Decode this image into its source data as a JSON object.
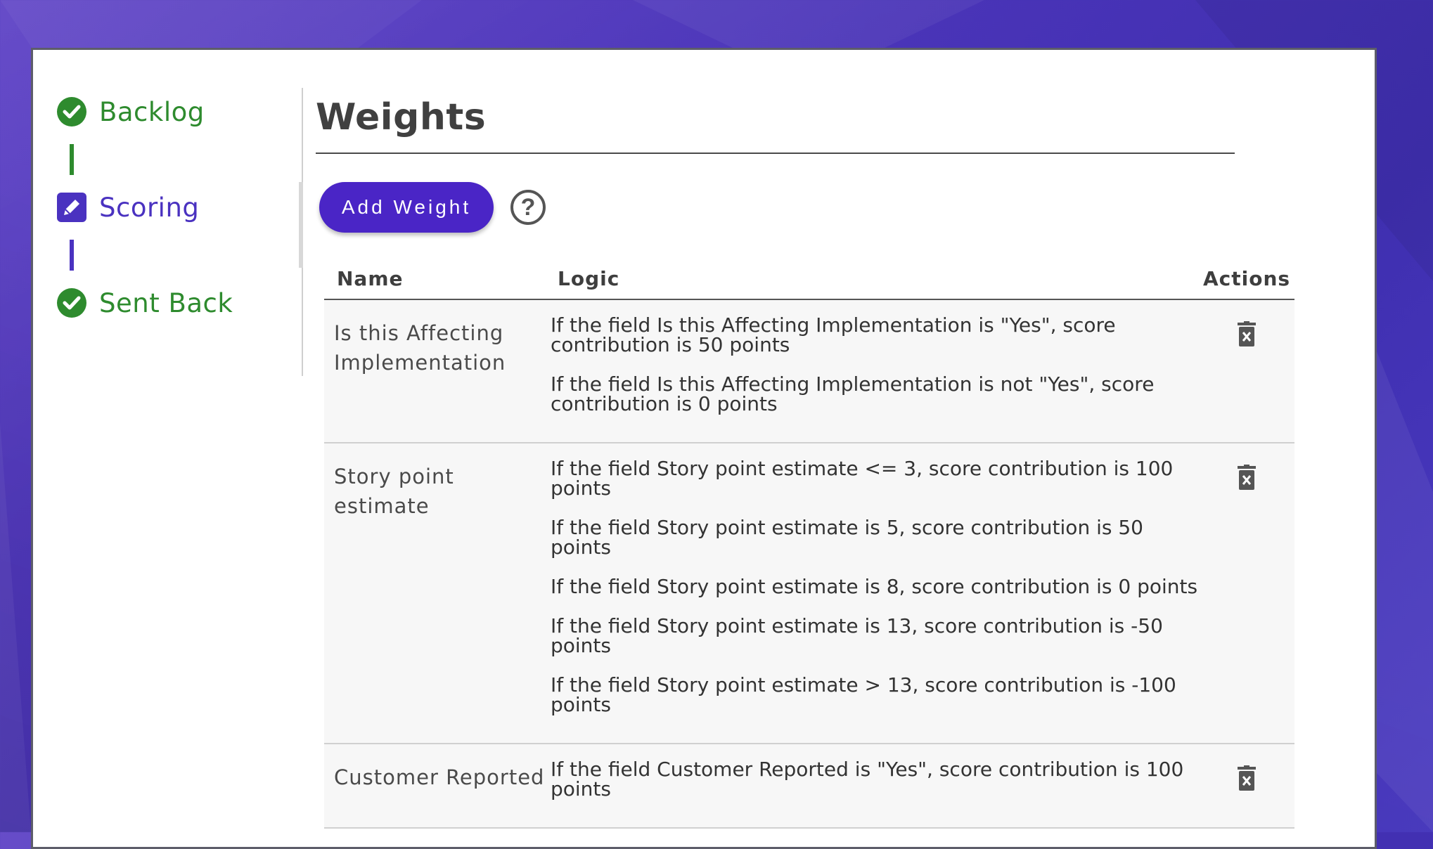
{
  "stepper": {
    "steps": [
      {
        "label": "Backlog",
        "state": "done",
        "icon": "check-circle-icon"
      },
      {
        "label": "Scoring",
        "state": "active",
        "icon": "pencil-icon"
      },
      {
        "label": "Sent Back",
        "state": "done",
        "icon": "check-circle-icon"
      }
    ]
  },
  "page": {
    "title": "Weights",
    "add_button_label": "Add Weight",
    "help_icon": "help-icon",
    "help_glyph": "?"
  },
  "table": {
    "headers": {
      "name": "Name",
      "logic": "Logic",
      "actions": "Actions"
    },
    "rows": [
      {
        "name": "Is this Affecting Implementation",
        "logic": [
          "If the field  Is this Affecting Implementation  is \"Yes\", score contribution is 50 points",
          "If the field  Is this Affecting Implementation is not \"Yes\", score contribution is 0 points"
        ]
      },
      {
        "name": "Story point estimate",
        "logic": [
          "If the field  Story point estimate <= 3, score contribution is 100 points",
          "If the field  Story point estimate  is 5, score contribution is 50 points",
          "If the field  Story point estimate  is 8, score contribution is 0 points",
          "If the field  Story point estimate  is 13, score contribution is -50 points",
          "If the field  Story point estimate  > 13, score contribution is -100 points"
        ]
      },
      {
        "name": "Customer Reported",
        "logic": [
          "If the field  Customer Reported  is \"Yes\", score contribution is 100 points"
        ]
      }
    ]
  },
  "colors": {
    "done": "#2e8b2e",
    "active": "#4a32c0",
    "button": "#4a25c6"
  }
}
